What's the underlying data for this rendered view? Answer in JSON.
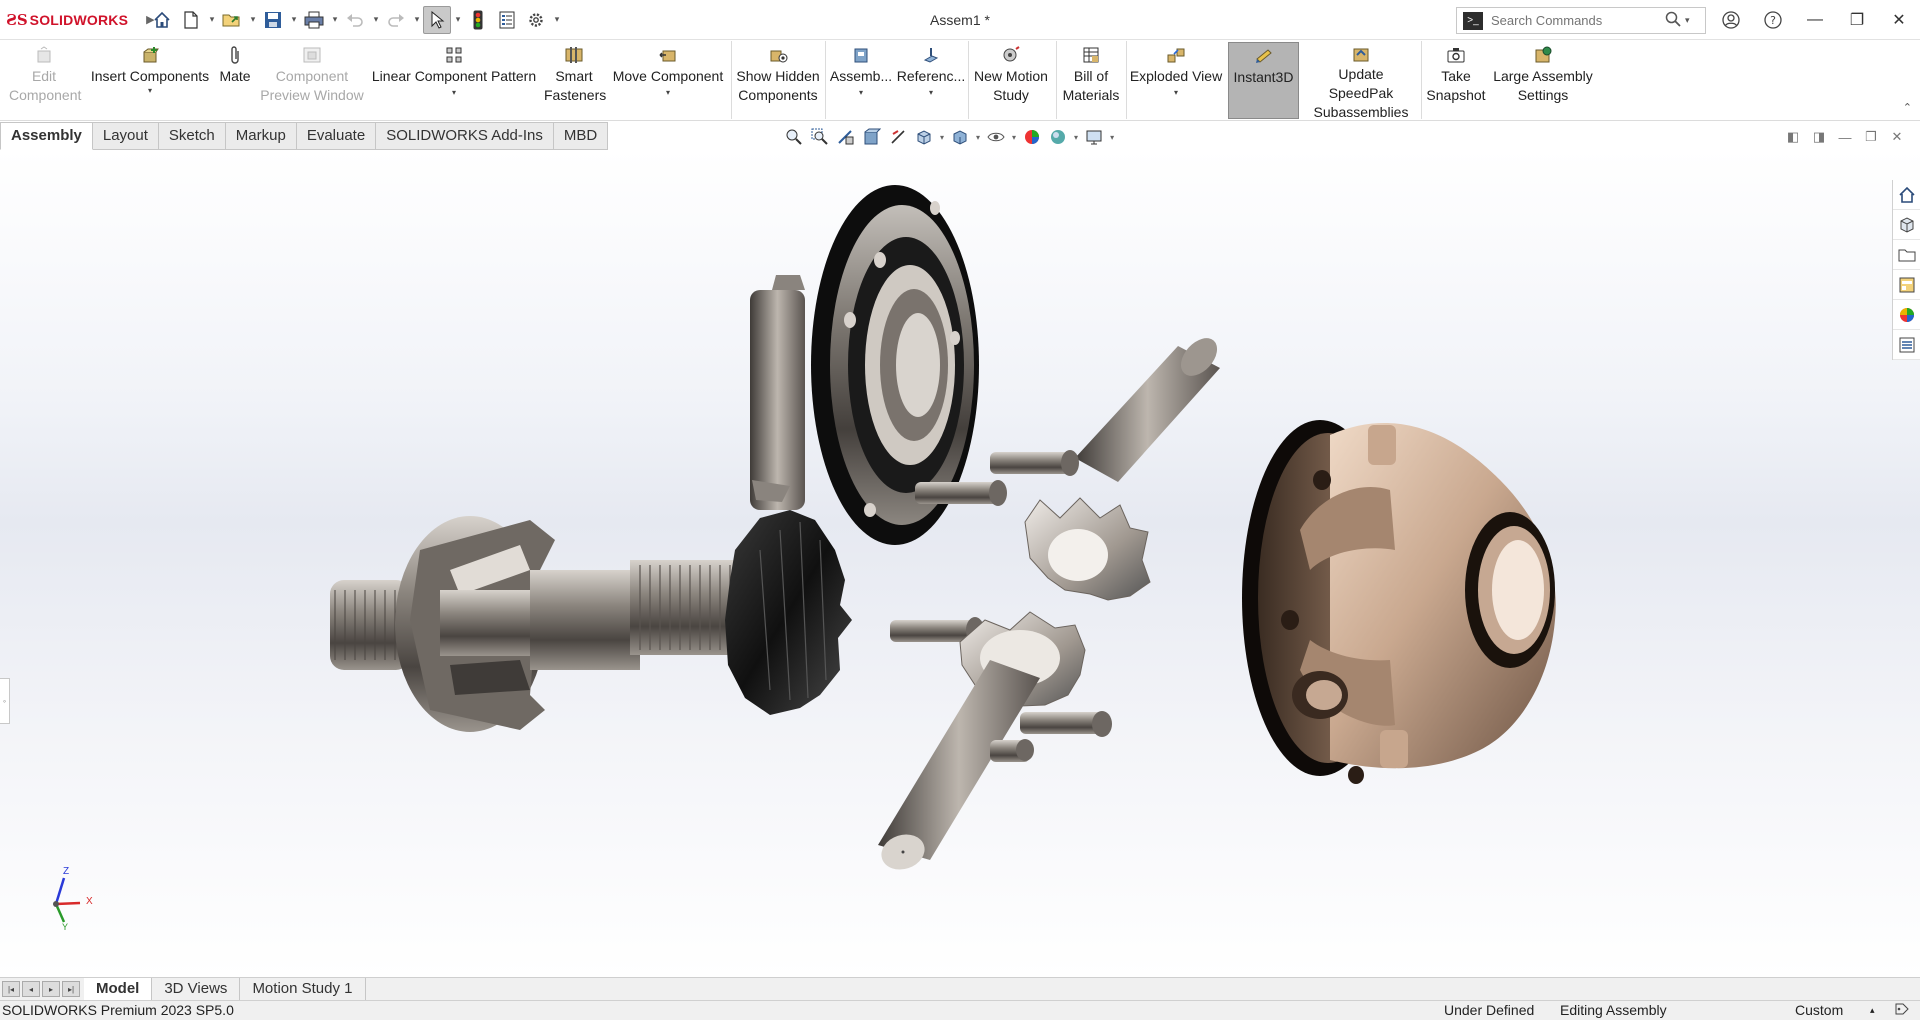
{
  "app": {
    "logo_text": "SOLIDWORKS",
    "doc_title": "Assem1 *"
  },
  "search": {
    "placeholder": "Search Commands"
  },
  "ribbon": {
    "edit_component": "Edit Component",
    "insert_components": "Insert Components",
    "mate": "Mate",
    "component_preview": "Component Preview Window",
    "linear_pattern": "Linear Component Pattern",
    "smart_fasteners": "Smart Fasteners",
    "move_component": "Move Component",
    "show_hidden": "Show Hidden Components",
    "assembly": "Assemb...",
    "reference": "Referenc...",
    "new_motion_study": "New Motion Study",
    "bill_of_materials": "Bill of Materials",
    "exploded_view": "Exploded View",
    "instant3d": "Instant3D",
    "update_speedpak": "Update SpeedPak Subassemblies",
    "take_snapshot": "Take Snapshot",
    "large_assembly_settings": "Large Assembly Settings"
  },
  "tabs": [
    "Assembly",
    "Layout",
    "Sketch",
    "Markup",
    "Evaluate",
    "SOLIDWORKS Add-Ins",
    "MBD"
  ],
  "triad": {
    "z": "Z",
    "x": "X",
    "y": "Y"
  },
  "bottom_tabs": [
    "Model",
    "3D Views",
    "Motion Study 1"
  ],
  "status": {
    "version": "SOLIDWORKS Premium 2023 SP5.0",
    "defined": "Under Defined",
    "mode": "Editing Assembly",
    "units": "Custom"
  },
  "colors": {
    "brand": "#d0122a",
    "tan_part": "#c9a88f",
    "steel": "#8f8a84",
    "dark_part": "#1c1c1c"
  }
}
